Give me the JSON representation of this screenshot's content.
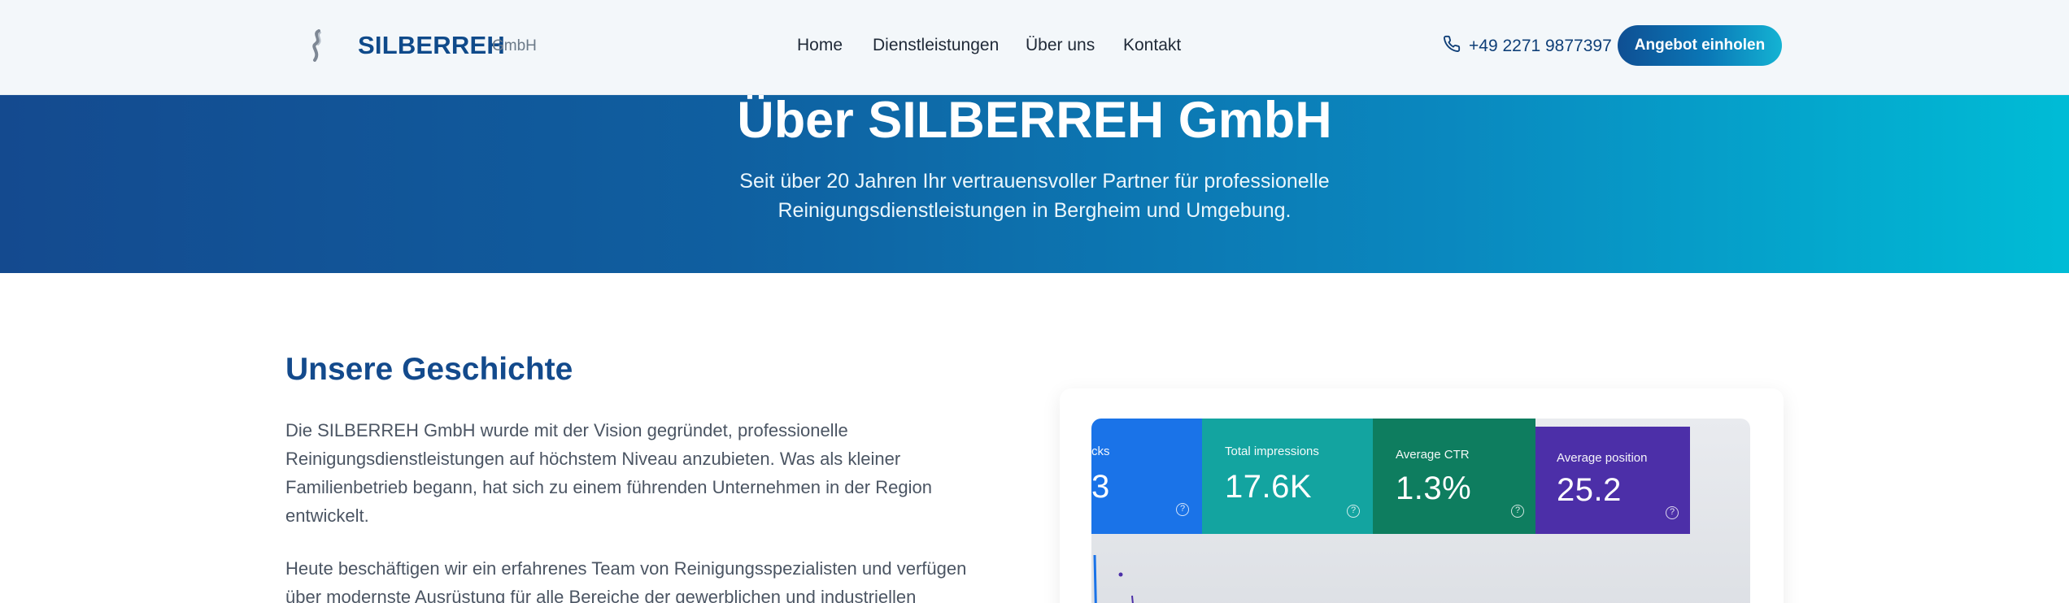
{
  "header": {
    "logo_name": "SILBERREH",
    "logo_suffix": "GmbH",
    "nav": [
      "Home",
      "Dienstleistungen",
      "Über uns",
      "Kontakt"
    ],
    "phone": "+49 2271 9877397",
    "cta_label": "Angebot einholen"
  },
  "hero": {
    "title": "Über SILBERREH GmbH",
    "subtitle_line1": "Seit über 20 Jahren Ihr vertrauensvoller Partner für professionelle",
    "subtitle_line2": "Reinigungsdienstleistungen in Bergheim und Umgebung."
  },
  "story": {
    "title": "Unsere Geschichte",
    "paragraph1": "Die SILBERREH GmbH wurde mit der Vision gegründet, professionelle Reinigungsdienstleistungen auf höchstem Niveau anzubieten. Was als kleiner Familienbetrieb begann, hat sich zu einem führenden Unternehmen in der Region entwickelt.",
    "paragraph2": "Heute beschäftigen wir ein erfahrenes Team von Reinigungsspezialisten und verfügen über modernste Ausrüstung für alle Bereiche der gewerblichen und industriellen"
  },
  "photo": {
    "tiles": [
      {
        "label": "cks",
        "value": "3",
        "color": "#1a73e8"
      },
      {
        "label": "Total impressions",
        "value": "17.6K",
        "color": "#13a4a0"
      },
      {
        "label": "Average CTR",
        "value": "1.3%",
        "color": "#0e7d5f"
      },
      {
        "label": "Average position",
        "value": "25.2",
        "color": "#4c2fa8"
      }
    ],
    "help_glyph": "?"
  },
  "colors": {
    "brand": "#134a8c",
    "hero_start": "#144a8f",
    "hero_end": "#00bcd6"
  }
}
